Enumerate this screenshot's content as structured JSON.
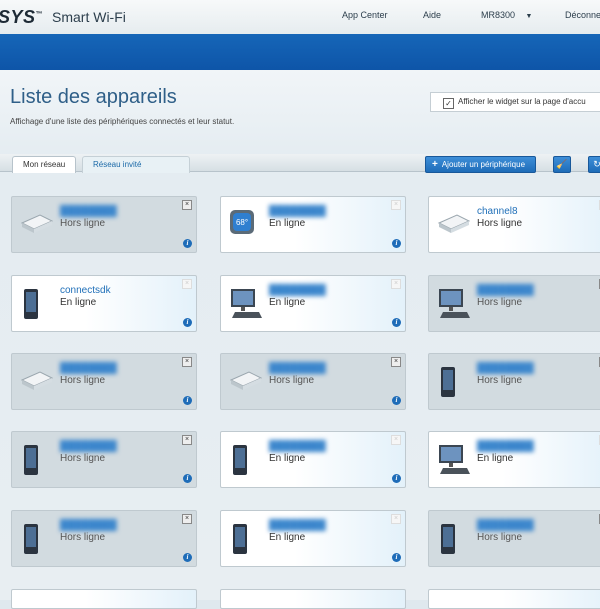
{
  "header": {
    "brand": "SYS",
    "product": "Smart Wi-Fi",
    "nav": [
      "App Center",
      "Aide",
      "MR8300",
      "Déconne"
    ]
  },
  "page": {
    "title": "Liste des appareils",
    "subtitle": "Affichage d'une liste des périphériques connectés et leur statut.",
    "widget_label": "Afficher le widget sur la page d'accu"
  },
  "tabs": [
    "Mon réseau",
    "Réseau invité"
  ],
  "toolbar": {
    "add_label": "Ajouter un périphérique"
  },
  "devices": [
    {
      "name": "",
      "status": "Hors ligne",
      "online": false,
      "icon": "router-icon"
    },
    {
      "name": "",
      "status": "En ligne",
      "online": true,
      "icon": "thermostat-icon",
      "reading": "68°"
    },
    {
      "name": "channel8",
      "status": "Hors ligne",
      "online": true,
      "icon": "router-icon"
    },
    {
      "name": "connectsdk",
      "status": "En ligne",
      "online": true,
      "icon": "phone-icon"
    },
    {
      "name": "",
      "status": "En ligne",
      "online": true,
      "icon": "computer-icon"
    },
    {
      "name": "",
      "status": "Hors ligne",
      "online": false,
      "icon": "computer-icon"
    },
    {
      "name": "",
      "status": "Hors ligne",
      "online": false,
      "icon": "router-icon"
    },
    {
      "name": "",
      "status": "Hors ligne",
      "online": false,
      "icon": "router-icon"
    },
    {
      "name": "",
      "status": "Hors ligne",
      "online": false,
      "icon": "phone-icon"
    },
    {
      "name": "",
      "status": "Hors ligne",
      "online": false,
      "icon": "phone-icon"
    },
    {
      "name": "",
      "status": "En ligne",
      "online": true,
      "icon": "phone-icon"
    },
    {
      "name": "",
      "status": "En ligne",
      "online": true,
      "icon": "computer-icon"
    },
    {
      "name": "",
      "status": "Hors ligne",
      "online": false,
      "icon": "phone-icon"
    },
    {
      "name": "",
      "status": "En ligne",
      "online": true,
      "icon": "phone-icon"
    },
    {
      "name": "",
      "status": "Hors ligne",
      "online": false,
      "icon": "phone-icon"
    }
  ]
}
